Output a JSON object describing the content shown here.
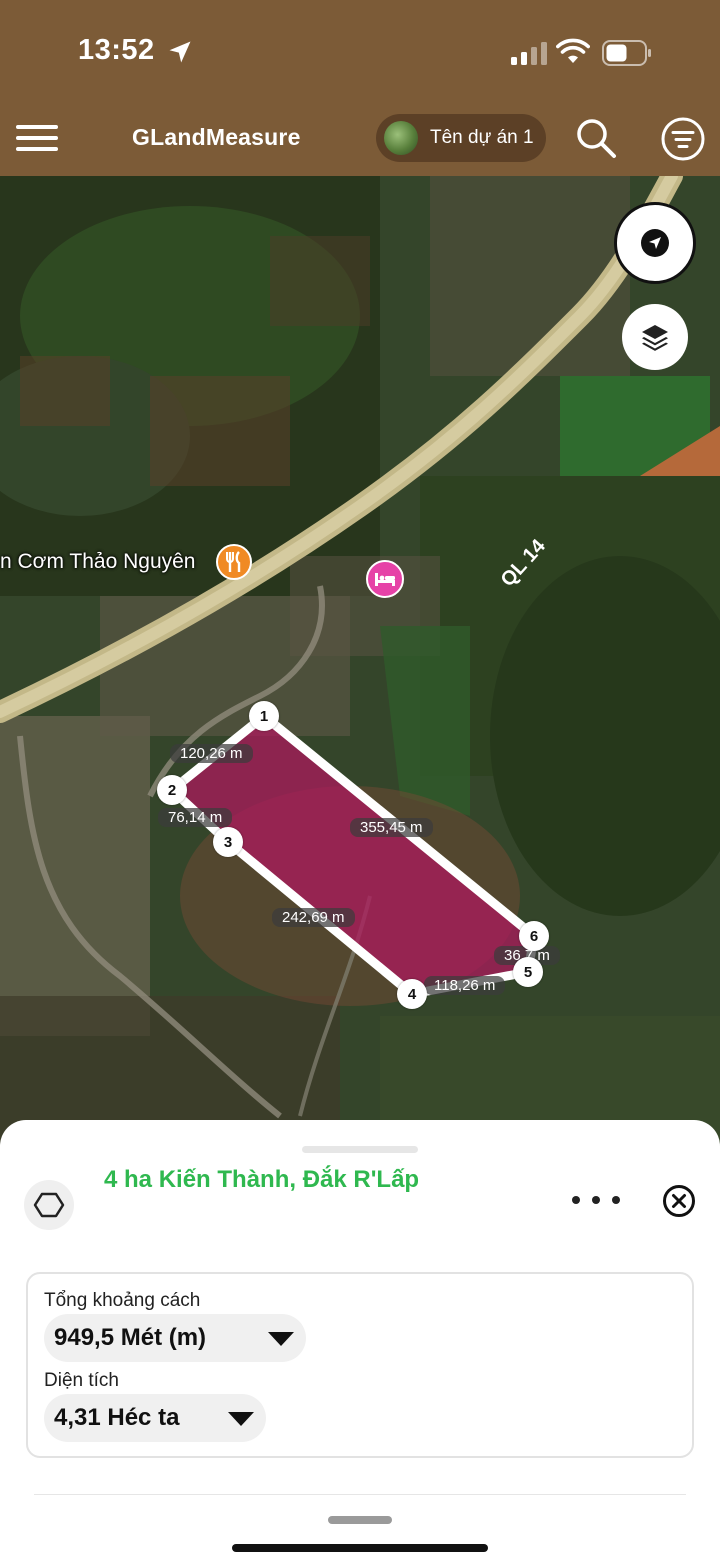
{
  "status_bar": {
    "time": "13:52"
  },
  "header": {
    "title": "GLandMeasure",
    "project_name": "Tên dự án 1"
  },
  "map": {
    "road_label": "QL 14",
    "poi_restaurant": "n Cơm Thảo Nguyên",
    "vertices": [
      "1",
      "2",
      "3",
      "4",
      "5",
      "6"
    ],
    "distances": [
      "120,26 m",
      "76,14 m",
      "355,45 m",
      "242,69 m",
      "36,7 m",
      "118,26 m"
    ],
    "polygon_fill": "#b0185e",
    "outline_color": "#ffffff"
  },
  "sheet": {
    "title": "4 ha Kiến Thành, Đắk R'Lấp",
    "title_color": "#2fb84f",
    "distance_label": "Tổng khoảng cách",
    "distance_value": "949,5 Mét (m)",
    "area_label": "Diện tích",
    "area_value": "4,31 Héc ta"
  },
  "icons": {
    "menu": "hamburger-icon",
    "search": "search-icon",
    "filter": "filter-icon",
    "locate": "navigation-arrow-icon",
    "layers": "layers-icon",
    "shape": "hexagon-icon",
    "more": "more-horizontal-icon",
    "close": "close-circle-icon"
  }
}
